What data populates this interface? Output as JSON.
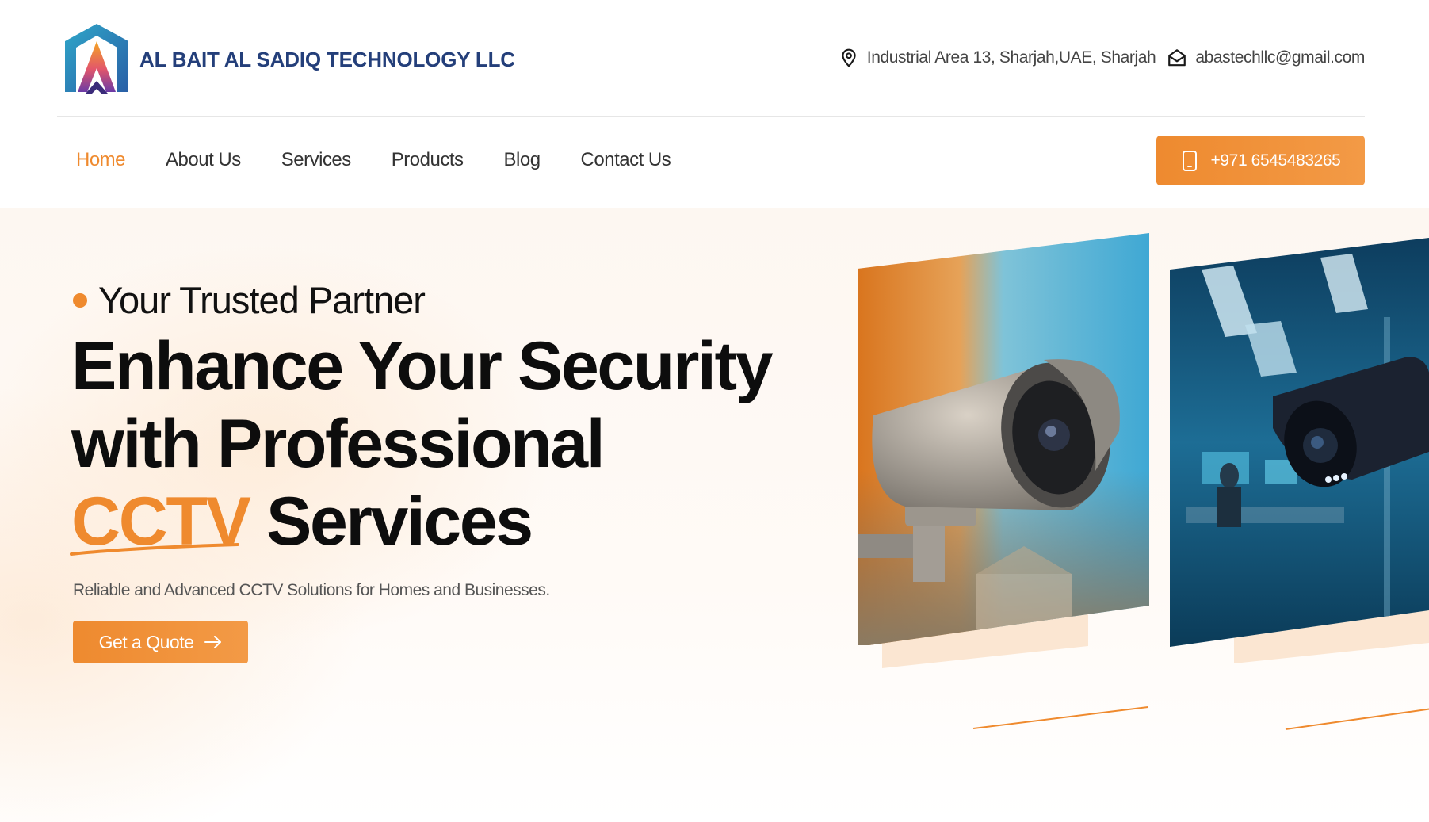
{
  "header": {
    "brand": "AL BAIT AL SADIQ TECHNOLOGY LLC",
    "address": "Industrial Area 13, Sharjah,UAE, Sharjah",
    "email": "abastechllc@gmail.com"
  },
  "nav": {
    "items": [
      {
        "label": "Home",
        "active": true
      },
      {
        "label": "About Us"
      },
      {
        "label": "Services"
      },
      {
        "label": "Products"
      },
      {
        "label": "Blog"
      },
      {
        "label": "Contact Us"
      }
    ],
    "phone_label": "+971 6545483265"
  },
  "hero": {
    "tagline": "Your Trusted Partner",
    "headline_line1": "Enhance Your Security",
    "headline_line2": "with Professional",
    "headline_accent": "CCTV",
    "headline_rest": " Services",
    "subtext": "Reliable and Advanced CCTV Solutions for Homes and Businesses.",
    "cta_label": "Get a Quote"
  },
  "icons": {
    "location": "map-pin-icon",
    "email": "envelope-open-icon",
    "phone": "mobile-phone-icon",
    "cta": "arrow-right-icon"
  },
  "colors": {
    "accent": "#ef8a2e",
    "brand_blue": "#243f7a",
    "text": "#0d0d0d"
  }
}
